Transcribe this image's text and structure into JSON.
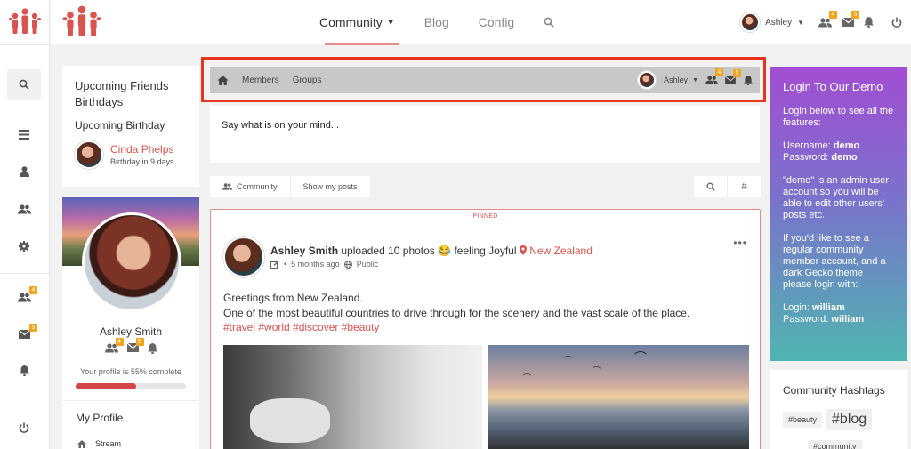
{
  "colors": {
    "accent": "#d9534f",
    "badge": "#f2a51a",
    "highlight": "#e8331e",
    "demo_top": "#a24dd2",
    "demo_bottom": "#4fb5b0"
  },
  "rail": {
    "items": [
      {
        "icon": "search-icon"
      },
      {
        "icon": "list-icon"
      },
      {
        "icon": "user-icon"
      },
      {
        "icon": "users-icon"
      },
      {
        "icon": "gear-icon"
      },
      {
        "icon": "friend-requests-icon",
        "badge": "4"
      },
      {
        "icon": "mail-icon",
        "badge": "5"
      },
      {
        "icon": "bell-icon"
      },
      {
        "icon": "power-icon"
      }
    ]
  },
  "topnav": {
    "menu": [
      {
        "label": "Community"
      },
      {
        "label": "Blog"
      },
      {
        "label": "Config"
      }
    ],
    "username": "Ashley",
    "friends_badge": "4",
    "mail_badge": "5"
  },
  "birthdays": {
    "title": "Upcoming Friends Birthdays",
    "subtitle": "Upcoming Birthday",
    "person": {
      "name": "Cinda Phelps",
      "when": "Birthday in 9 days."
    }
  },
  "profile": {
    "name": "Ashley Smith",
    "friends_badge": "4",
    "mail_badge": "5",
    "complete_text": "Your profile is 55% complete",
    "complete_pct": 55,
    "section_title": "My Profile",
    "first_link": "Stream"
  },
  "subnav": {
    "links": [
      "Members",
      "Groups"
    ],
    "username": "Ashley",
    "friends_badge": "4",
    "mail_badge": "5"
  },
  "composer": {
    "placeholder": "Say what is on your mind..."
  },
  "filters": {
    "community": "Community",
    "my_posts": "Show my posts",
    "hash": "#"
  },
  "post": {
    "pinned": "PINNED",
    "author": "Ashley Smith",
    "action": "uploaded 10 photos",
    "emoji": "😂",
    "feeling": "feeling Joyful",
    "location": "New Zealand",
    "time": "5 months ago",
    "privacy": "Public",
    "line1": "Greetings from New Zealand.",
    "line2": "One of the most beautiful countries to drive through for the scenery and the vast scale of the place.",
    "tags": "#travel #world #discover #beauty"
  },
  "demo": {
    "title": "Login To Our Demo",
    "intro": "Login below to see all the features:",
    "username_label": "Username:",
    "username_value": "demo",
    "password_label": "Password:",
    "password_value": "demo",
    "admin_note": "\"demo\" is an admin user account so you will be able to edit other users' posts etc.",
    "regular_note": "If you'd like to see a regular community member account, and a dark Gecko theme please login with:",
    "login_label": "Login:",
    "login_value": "william",
    "password2_label": "Password:",
    "password2_value": "william"
  },
  "hashtags": {
    "title": "Community Hashtags",
    "tags": [
      "#beauty",
      "#blog",
      "#community"
    ]
  }
}
